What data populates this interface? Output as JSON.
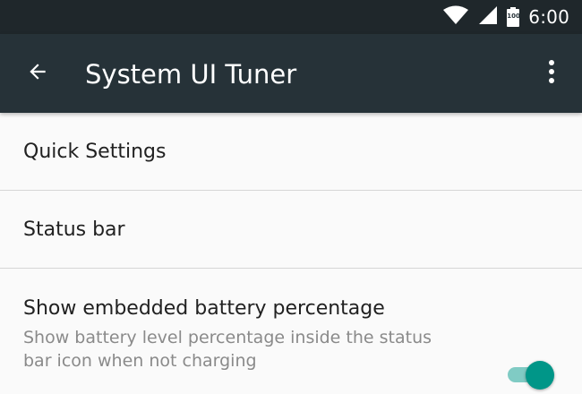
{
  "status_bar": {
    "time": "6:00",
    "battery_level": "100"
  },
  "app_bar": {
    "title": "System UI Tuner"
  },
  "list": {
    "items": [
      {
        "title": "Quick Settings"
      },
      {
        "title": "Status bar"
      },
      {
        "title": "Show embedded battery percentage",
        "summary": "Show battery level percentage inside the status bar icon when not charging",
        "toggle_on": true
      }
    ]
  },
  "colors": {
    "status_bar_bg": "#1F272B",
    "app_bar_bg": "#263238",
    "accent": "#009688",
    "accent_track": "#80CBC4",
    "background": "#FAFAFA"
  },
  "icons": {
    "back": "arrow-back-icon",
    "overflow": "more-vert-icon",
    "wifi": "wifi-icon",
    "cell": "cell-signal-icon",
    "battery": "battery-icon"
  }
}
